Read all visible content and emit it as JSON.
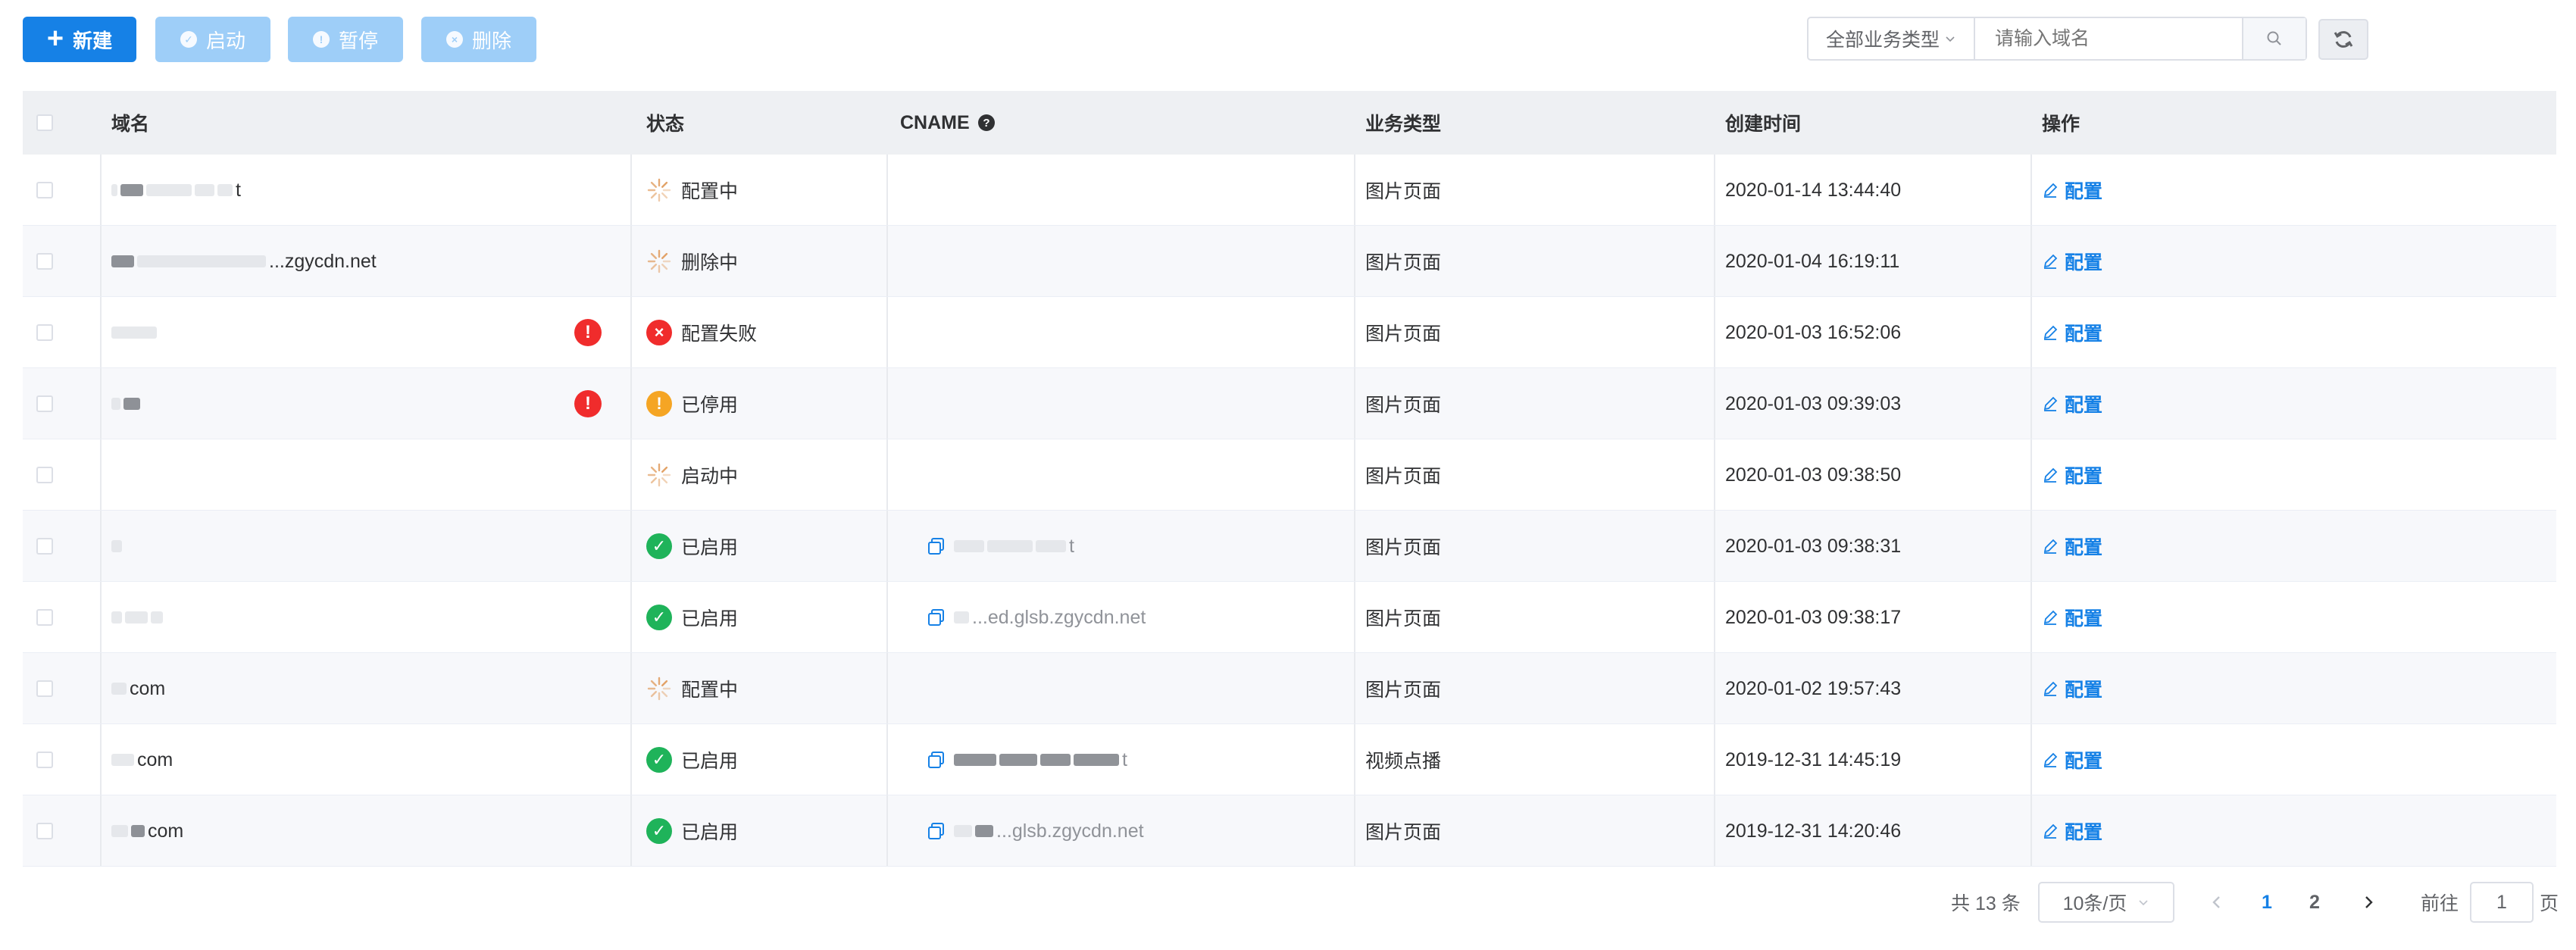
{
  "toolbar": {
    "new_label": "新建",
    "start_label": "启动",
    "pause_label": "暂停",
    "delete_label": "删除",
    "filter_select": "全部业务类型",
    "search_placeholder": "请输入域名"
  },
  "table": {
    "headers": {
      "domain": "域名",
      "status": "状态",
      "cname": "CNAME",
      "biz_type": "业务类型",
      "created": "创建时间",
      "action": "操作"
    },
    "rows": [
      {
        "domain": "t",
        "warn": false,
        "status": "配置中",
        "status_kind": "pending",
        "cname": "",
        "biz_type": "图片页面",
        "created": "2020-01-14 13:44:40",
        "action": "配置"
      },
      {
        "domain": "...zgycdn.net",
        "warn": false,
        "status": "删除中",
        "status_kind": "pending",
        "cname": "",
        "biz_type": "图片页面",
        "created": "2020-01-04 16:19:11",
        "action": "配置"
      },
      {
        "domain": "",
        "warn": true,
        "status": "配置失败",
        "status_kind": "fail",
        "cname": "",
        "biz_type": "图片页面",
        "created": "2020-01-03 16:52:06",
        "action": "配置"
      },
      {
        "domain": "",
        "warn": true,
        "status": "已停用",
        "status_kind": "stop",
        "cname": "",
        "biz_type": "图片页面",
        "created": "2020-01-03 09:39:03",
        "action": "配置"
      },
      {
        "domain": "",
        "warn": false,
        "status": "启动中",
        "status_kind": "pending",
        "cname": "",
        "biz_type": "图片页面",
        "created": "2020-01-03 09:38:50",
        "action": "配置"
      },
      {
        "domain": "",
        "warn": false,
        "status": "已启用",
        "status_kind": "ok",
        "cname": "t",
        "biz_type": "图片页面",
        "created": "2020-01-03 09:38:31",
        "action": "配置"
      },
      {
        "domain": "",
        "warn": false,
        "status": "已启用",
        "status_kind": "ok",
        "cname": "...ed.glsb.zgycdn.net",
        "biz_type": "图片页面",
        "created": "2020-01-03 09:38:17",
        "action": "配置"
      },
      {
        "domain": "com",
        "warn": false,
        "status": "配置中",
        "status_kind": "pending",
        "cname": "",
        "biz_type": "图片页面",
        "created": "2020-01-02 19:57:43",
        "action": "配置"
      },
      {
        "domain": "com",
        "warn": false,
        "status": "已启用",
        "status_kind": "ok",
        "cname": "t",
        "biz_type": "视频点播",
        "created": "2019-12-31 14:45:19",
        "action": "配置"
      },
      {
        "domain": "com",
        "warn": false,
        "status": "已启用",
        "status_kind": "ok",
        "cname": "...glsb.zgycdn.net",
        "biz_type": "图片页面",
        "created": "2019-12-31 14:20:46",
        "action": "配置"
      }
    ]
  },
  "pagination": {
    "total": "共 13 条",
    "page_size": "10条/页",
    "page1": "1",
    "page2": "2",
    "goto": "前往",
    "goto_value": "1",
    "page_suffix": "页"
  },
  "colors": {
    "primary": "#1681e6",
    "ok": "#1fb35a",
    "fail": "#f02c2c",
    "stop": "#f5a524",
    "pending": "#e09a5a"
  }
}
